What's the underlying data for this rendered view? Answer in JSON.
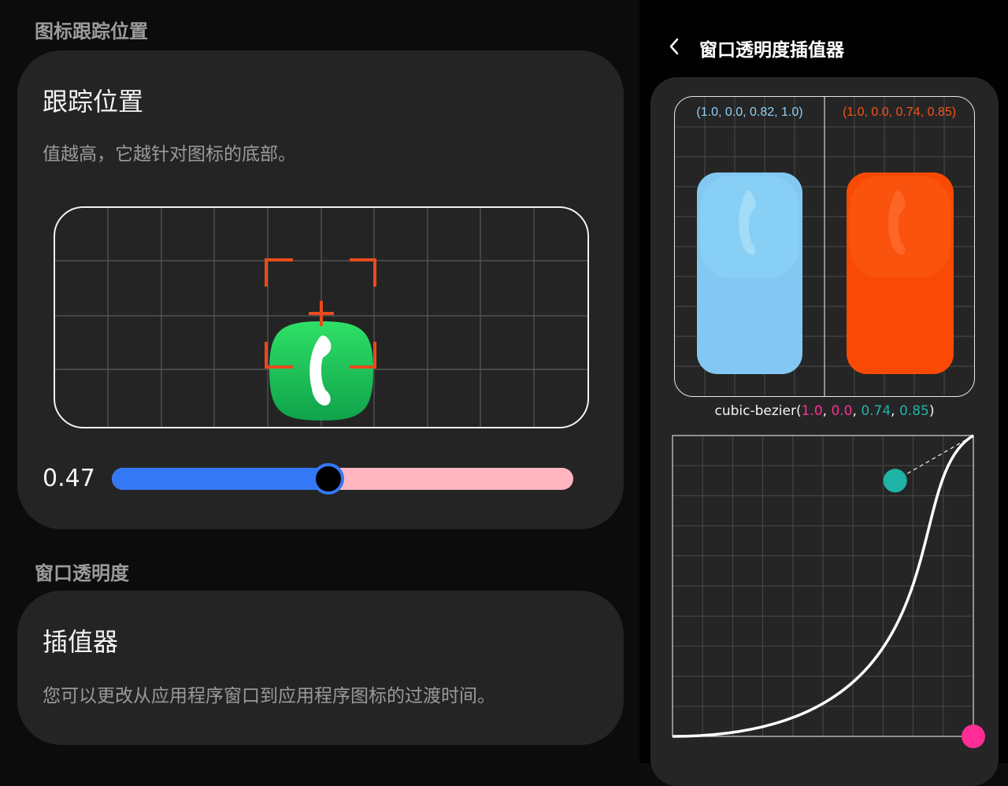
{
  "left": {
    "tracking_section": {
      "title": "图标跟踪位置",
      "card_title": "跟踪位置",
      "description": "值越高，它越针对图标的底部。",
      "slider": {
        "value_label": "0.47",
        "value": 0.47
      }
    },
    "opacity_section": {
      "title": "窗口透明度",
      "card_title": "插值器",
      "description": "您可以更改从应用程序窗口到应用程序图标的过渡时间。"
    }
  },
  "right": {
    "title": "窗口透明度插值器",
    "back_icon": "chevron-left-icon",
    "preview": {
      "left_label": "(1.0, 0.0, 0.82, 1.0)",
      "right_label": "(1.0, 0.0, 0.74, 0.85)",
      "left_color": "#82c8f2",
      "right_color": "#f84a04"
    },
    "curve": {
      "prefix": "cubic-bezier(",
      "p1": "1.0",
      "sep1": ", ",
      "p2": "0.0",
      "sep2": ", ",
      "p3": "0.74",
      "sep3": ", ",
      "p4": "0.85",
      "suffix": ")",
      "values": [
        1.0,
        0.0,
        0.74,
        0.85
      ],
      "p1_color": "#ff2d95",
      "p2_color": "#1fb3a8"
    }
  },
  "colors": {
    "accent_blue": "#3478f6",
    "track_pink": "#ffb6c1",
    "target_orange": "#e8461a",
    "phone_green": "#1fc554"
  }
}
